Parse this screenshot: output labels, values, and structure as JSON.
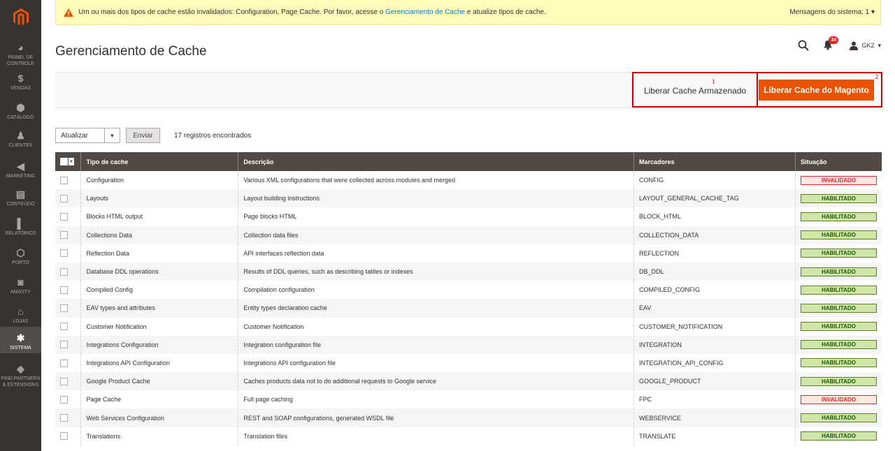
{
  "sidebar": {
    "items": [
      {
        "label": "PAINEL DE CONTROLE",
        "icon": "dashboard-icon",
        "glyph": "◕",
        "active": false
      },
      {
        "label": "VENDAS",
        "icon": "dollar-icon",
        "glyph": "$",
        "active": false
      },
      {
        "label": "CATÁLOGO",
        "icon": "box-icon",
        "glyph": "⬢",
        "active": false
      },
      {
        "label": "CLIENTES",
        "icon": "person-icon",
        "glyph": "♟",
        "active": false
      },
      {
        "label": "MARKETING",
        "icon": "megaphone-icon",
        "glyph": "◀",
        "active": false
      },
      {
        "label": "CONTEÚDO",
        "icon": "content-icon",
        "glyph": "▤",
        "active": false
      },
      {
        "label": "RELATÓRIOS",
        "icon": "bar-chart-icon",
        "glyph": "▌",
        "active": false
      },
      {
        "label": "PORTO",
        "icon": "hexagon-icon",
        "glyph": "⬡",
        "active": false
      },
      {
        "label": "AMASTY",
        "icon": "amasty-icon",
        "glyph": "◙",
        "active": false
      },
      {
        "label": "LOJAS",
        "icon": "store-icon",
        "glyph": "⌂",
        "active": false
      },
      {
        "label": "SISTEMA",
        "icon": "gear-icon",
        "glyph": "✱",
        "active": true
      },
      {
        "label": "FIND PARTNERS & EXTENSIONS",
        "icon": "cube-icon",
        "glyph": "◈",
        "active": false
      }
    ]
  },
  "notice": {
    "text_before": "Um ou mais dos tipos de cache estão invalidados: Configuration, Page Cache. Por favor, acesse o ",
    "link": "Gerenciamento de Cache",
    "text_after": " e atualize tipos de cache.",
    "system_messages": "Mensagens do sistema: 1"
  },
  "page": {
    "title": "Gerenciamento de Cache"
  },
  "header": {
    "notifications_count": "34",
    "user": "GK2"
  },
  "actions": {
    "flush_storage": "Liberar Cache Armazenado",
    "flush_storage_marker": "1",
    "flush_magento": "Liberar Cache do Magento",
    "flush_magento_marker": "2"
  },
  "massaction": {
    "selected": "Atualizar",
    "submit": "Enviar",
    "records": "17 registros encontrados"
  },
  "grid": {
    "columns": [
      "Tipo de cache",
      "Descrição",
      "Marcadores",
      "Situação"
    ],
    "rows": [
      {
        "type": "Configuration",
        "desc": "Various XML configurations that were collected across modules and merged",
        "tags": "CONFIG",
        "status": "INVALIDADO",
        "ok": false
      },
      {
        "type": "Layouts",
        "desc": "Layout building instructions",
        "tags": "LAYOUT_GENERAL_CACHE_TAG",
        "status": "HABILITADO",
        "ok": true
      },
      {
        "type": "Blocks HTML output",
        "desc": "Page blocks HTML",
        "tags": "BLOCK_HTML",
        "status": "HABILITADO",
        "ok": true
      },
      {
        "type": "Collections Data",
        "desc": "Collection data files",
        "tags": "COLLECTION_DATA",
        "status": "HABILITADO",
        "ok": true
      },
      {
        "type": "Reflection Data",
        "desc": "API interfaces reflection data",
        "tags": "REFLECTION",
        "status": "HABILITADO",
        "ok": true
      },
      {
        "type": "Database DDL operations",
        "desc": "Results of DDL queries, such as describing tables or indexes",
        "tags": "DB_DDL",
        "status": "HABILITADO",
        "ok": true
      },
      {
        "type": "Compiled Config",
        "desc": "Compilation configuration",
        "tags": "COMPILED_CONFIG",
        "status": "HABILITADO",
        "ok": true
      },
      {
        "type": "EAV types and attributes",
        "desc": "Entity types declaration cache",
        "tags": "EAV",
        "status": "HABILITADO",
        "ok": true
      },
      {
        "type": "Customer Notification",
        "desc": "Customer Notification",
        "tags": "CUSTOMER_NOTIFICATION",
        "status": "HABILITADO",
        "ok": true
      },
      {
        "type": "Integrations Configuration",
        "desc": "Integration configuration file",
        "tags": "INTEGRATION",
        "status": "HABILITADO",
        "ok": true
      },
      {
        "type": "Integrations API Configuration",
        "desc": "Integrations API configuration file",
        "tags": "INTEGRATION_API_CONFIG",
        "status": "HABILITADO",
        "ok": true
      },
      {
        "type": "Google Product Cache",
        "desc": "Caches products data not to do additional requests to Google service",
        "tags": "GOOGLE_PRODUCT",
        "status": "HABILITADO",
        "ok": true
      },
      {
        "type": "Page Cache",
        "desc": "Full page caching",
        "tags": "FPC",
        "status": "INVALIDADO",
        "ok": false
      },
      {
        "type": "Web Services Configuration",
        "desc": "REST and SOAP configurations, generated WSDL file",
        "tags": "WEBSERVICE",
        "status": "HABILITADO",
        "ok": true
      },
      {
        "type": "Translations",
        "desc": "Translation files",
        "tags": "TRANSLATE",
        "status": "HABILITADO",
        "ok": true
      }
    ]
  },
  "colors": {
    "sidebar": "#373330",
    "accent": "#eb5202",
    "header_row": "#514943",
    "highlight_box": "#cc0000"
  }
}
